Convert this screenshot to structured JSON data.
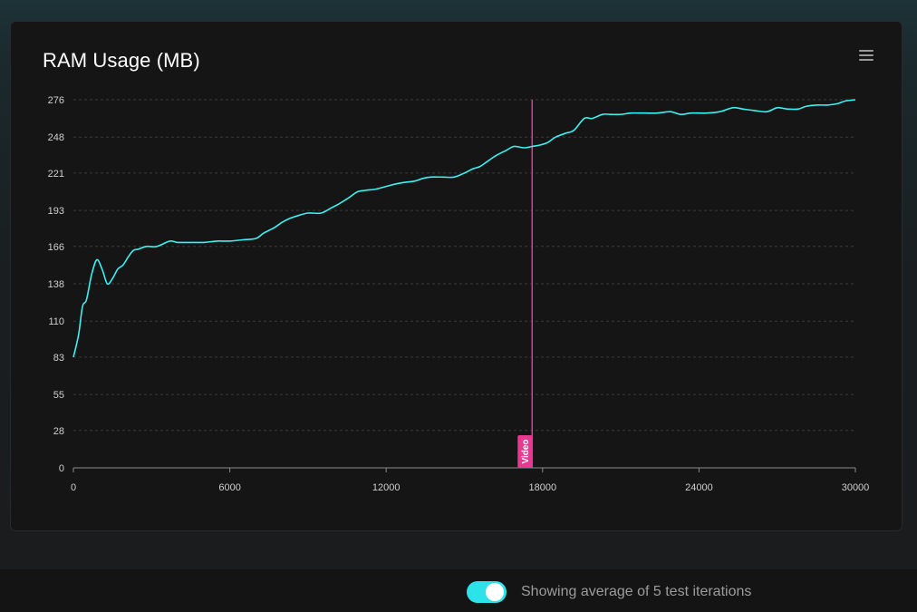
{
  "card": {
    "title": "RAM Usage (MB)",
    "menu_icon": "hamburger-menu-icon"
  },
  "chart_data": {
    "type": "line",
    "title": "RAM Usage (MB)",
    "xlabel": "",
    "ylabel": "",
    "xlim": [
      0,
      30000
    ],
    "ylim": [
      0,
      276
    ],
    "x_ticks": [
      "0",
      "6000",
      "12000",
      "18000",
      "24000",
      "30000"
    ],
    "y_ticks": [
      "0",
      "28",
      "55",
      "83",
      "110",
      "138",
      "166",
      "193",
      "221",
      "248",
      "276"
    ],
    "grid": "horizontal dashed",
    "colors": {
      "line": "#3af2f2",
      "marker": "#e6398f"
    },
    "series": [
      {
        "x": [
          0,
          200,
          350,
          500,
          700,
          900,
          1100,
          1300,
          1500,
          1700,
          1900,
          2100,
          2300,
          2500,
          2800,
          3200,
          3700,
          4000,
          4500,
          5000,
          5500,
          6000,
          6500,
          7000,
          7300,
          7700,
          8000,
          8300,
          8600,
          9000,
          9500,
          9900,
          10200,
          10600,
          10900,
          11200,
          11600,
          12000,
          12400,
          12700,
          13100,
          13400,
          13700,
          14200,
          14600,
          15000,
          15300,
          15600,
          15900,
          16200,
          16600,
          16900,
          17300,
          17600,
          17900,
          18200,
          18500,
          18900,
          19200,
          19600,
          19900,
          20300,
          20600,
          21000,
          21400,
          21900,
          22400,
          22900,
          23300,
          23700,
          24300,
          24800,
          25300,
          25700,
          26100,
          26600,
          27000,
          27400,
          27800,
          28100,
          28500,
          28900,
          29300,
          29600,
          30000
        ],
        "y": [
          83,
          100,
          121,
          126,
          145,
          156,
          149,
          138,
          142,
          149,
          152,
          158,
          163,
          164,
          166,
          166,
          170,
          169,
          169,
          169,
          170,
          170,
          171,
          172,
          176,
          180,
          184,
          187,
          189,
          191,
          191,
          195,
          198,
          203,
          207,
          208,
          209,
          211,
          213,
          214,
          215,
          217,
          218,
          218,
          218,
          221,
          224,
          226,
          230,
          234,
          238,
          241,
          240,
          241,
          242,
          244,
          248,
          251,
          253,
          262,
          262,
          265,
          265,
          265,
          266,
          266,
          266,
          267,
          265,
          266,
          266,
          267,
          270,
          269,
          268,
          267,
          270,
          269,
          269,
          271,
          272,
          272,
          273,
          275,
          276
        ]
      }
    ],
    "annotations": [
      {
        "type": "vertical_line",
        "x": 17600,
        "label": "Video"
      }
    ]
  },
  "footer": {
    "toggle_on": true,
    "toggle_label": "Showing average of 5 test iterations"
  }
}
